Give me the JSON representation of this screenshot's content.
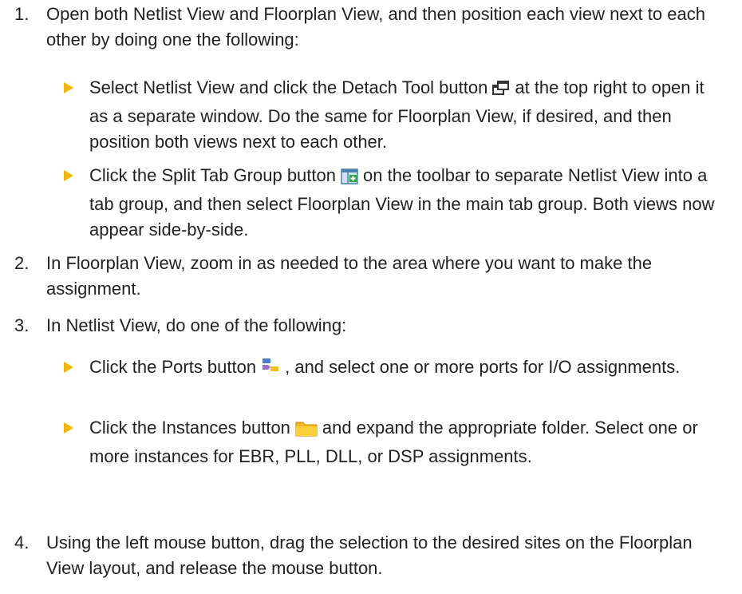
{
  "steps": [
    {
      "number": "1.",
      "text": "Open both Netlist View and Floorplan View, and then position each view next to each other by doing one the following:",
      "bullets": [
        {
          "before": "Select Netlist View and click the Detach Tool button",
          "icon": "detach-tool-icon",
          "after": "at the top right to open it as a separate window. Do the same for Floorplan View, if desired, and then position both views next to each other."
        },
        {
          "before": "Click the Split Tab Group button",
          "icon": "split-tab-group-icon",
          "after": "on the toolbar to separate Netlist View into a tab group, and then select Floorplan View in the main tab group. Both views now appear side-by-side."
        }
      ]
    },
    {
      "number": "2.",
      "text": "In Floorplan View, zoom in as needed to the area where you want to make the assignment."
    },
    {
      "number": "3.",
      "text": "In Netlist View, do one of the following:",
      "bullets": [
        {
          "before": "Click the Ports button",
          "icon": "ports-icon",
          "after": ", and select one or more ports for I/O assignments."
        },
        {
          "before": "Click the Instances button",
          "icon": "folder-icon",
          "after": "and expand the appropriate folder. Select one or more instances for EBR, PLL, DLL, or DSP assignments."
        }
      ]
    },
    {
      "number": "4.",
      "text": "Using the left mouse button, drag the selection to the desired sites on the Floorplan View layout, and release the mouse button."
    }
  ],
  "colors": {
    "bullet": "#f5b400",
    "text": "#222222"
  }
}
